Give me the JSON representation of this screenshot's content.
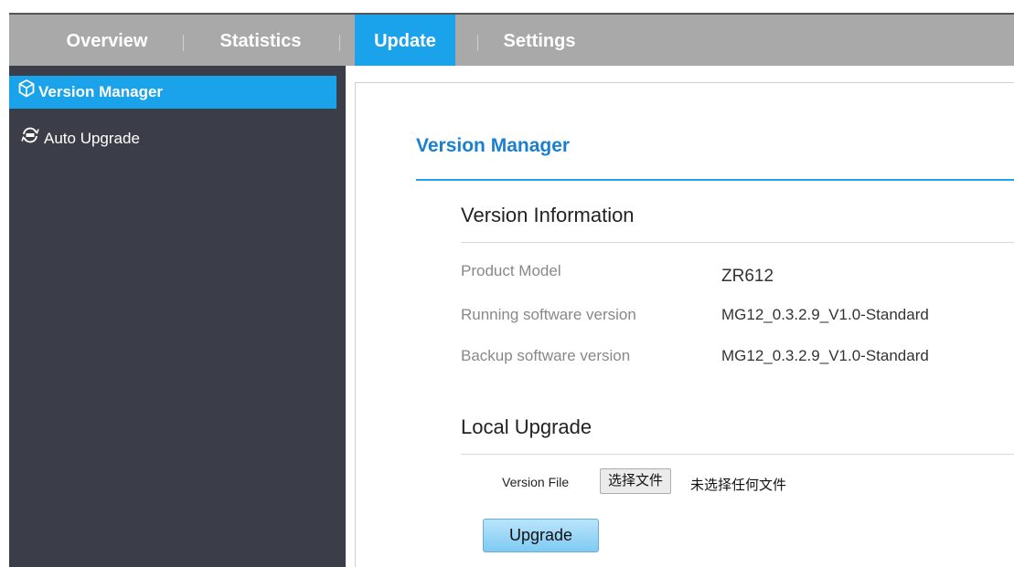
{
  "nav": {
    "tabs": [
      {
        "label": "Overview"
      },
      {
        "label": "Statistics"
      },
      {
        "label": "Update"
      },
      {
        "label": "Settings"
      }
    ],
    "active_tab": "Update",
    "accent_color": "#1aa3ea",
    "bar_color": "#a9a9a9"
  },
  "sidebar": {
    "background": "#3b3e48",
    "items": [
      {
        "label": "Version Manager",
        "icon": "cube-icon",
        "active": true
      },
      {
        "label": "Auto Upgrade",
        "icon": "sync-icon",
        "active": false
      }
    ]
  },
  "main": {
    "title": "Version Manager",
    "version_info": {
      "heading": "Version Information",
      "rows": [
        {
          "label": "Product Model",
          "value": "ZR612"
        },
        {
          "label": "Running software version",
          "value": "MG12_0.3.2.9_V1.0-Standard"
        },
        {
          "label": "Backup software version",
          "value": "MG12_0.3.2.9_V1.0-Standard"
        }
      ]
    },
    "local_upgrade": {
      "heading": "Local Upgrade",
      "file_label": "Version File",
      "file_button": "选择文件",
      "file_status": "未选择任何文件",
      "upgrade_button": "Upgrade"
    }
  }
}
